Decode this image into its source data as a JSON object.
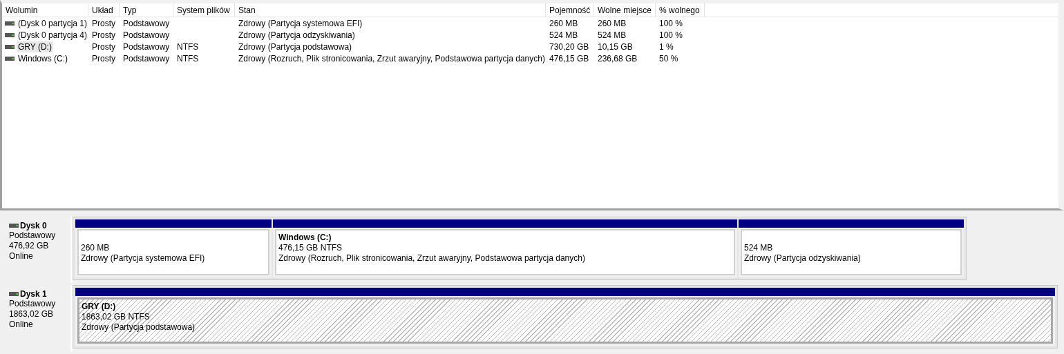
{
  "table": {
    "columns": [
      "Wolumin",
      "Układ",
      "Typ",
      "System plików",
      "Stan",
      "Pojemność",
      "Wolne miejsce",
      "% wolnego"
    ],
    "rows": [
      {
        "selected": false,
        "cells": [
          "(Dysk 0 partycja 1)",
          "Prosty",
          "Podstawowy",
          "",
          "Zdrowy (Partycja systemowa EFI)",
          "260 MB",
          "260 MB",
          "100 %"
        ]
      },
      {
        "selected": false,
        "cells": [
          "(Dysk 0 partycja 4)",
          "Prosty",
          "Podstawowy",
          "",
          "Zdrowy (Partycja odzyskiwania)",
          "524 MB",
          "524 MB",
          "100 %"
        ]
      },
      {
        "selected": true,
        "cells": [
          "GRY (D:)",
          "Prosty",
          "Podstawowy",
          "NTFS",
          "Zdrowy (Partycja podstawowa)",
          "730,20 GB",
          "10,15 GB",
          "1 %"
        ]
      },
      {
        "selected": false,
        "cells": [
          "Windows (C:)",
          "Prosty",
          "Podstawowy",
          "NTFS",
          "Zdrowy (Rozruch, Plik stronicowania, Zrzut awaryjny, Podstawowa partycja danych)",
          "476,15 GB",
          "236,68 GB",
          "50 %"
        ]
      }
    ]
  },
  "disks": [
    {
      "name": "Dysk 0",
      "type": "Podstawowy",
      "size": "476,92 GB",
      "status": "Online",
      "partitions": [
        {
          "selected": false,
          "lines": [
            "260 MB",
            "Zdrowy (Partycja systemowa EFI)"
          ]
        },
        {
          "selected": false,
          "label": "Windows  (C:)",
          "lines": [
            "476,15 GB NTFS",
            "Zdrowy (Rozruch, Plik stronicowania, Zrzut awaryjny, Podstawowa partycja danych)"
          ]
        },
        {
          "selected": false,
          "lines": [
            "524 MB",
            "Zdrowy (Partycja odzyskiwania)"
          ]
        }
      ]
    },
    {
      "name": "Dysk 1",
      "type": "Podstawowy",
      "size": "1863,02 GB",
      "status": "Online",
      "partitions": [
        {
          "selected": true,
          "label": "GRY  (D:)",
          "lines": [
            "1863,02 GB NTFS",
            "Zdrowy (Partycja podstawowa)"
          ]
        }
      ]
    }
  ]
}
